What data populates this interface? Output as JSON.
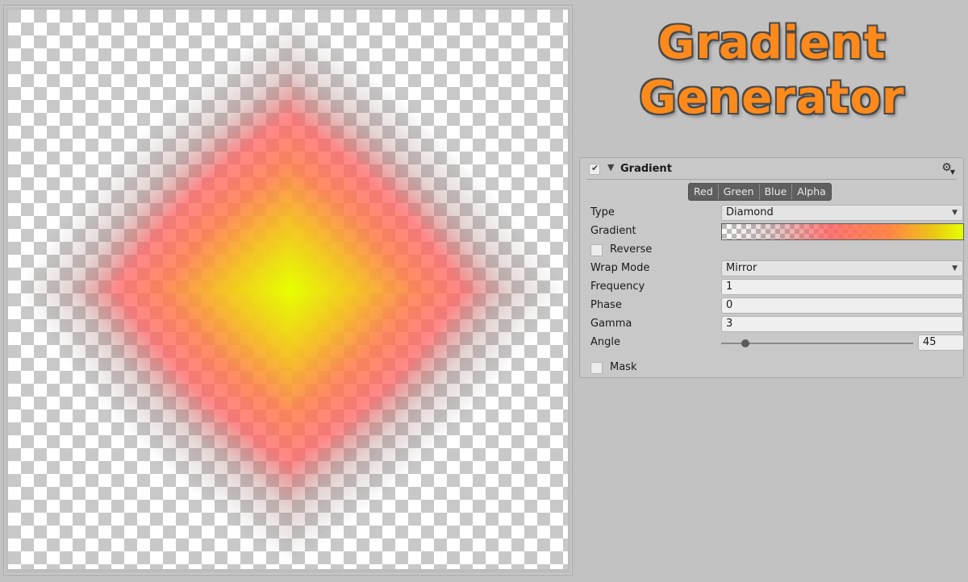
{
  "logo": {
    "line1": "Gradient",
    "line2": "Generator"
  },
  "preview": {
    "type": "Diamond",
    "gradient_stops": [
      "transparent",
      "#ff6060",
      "#ff8a3c",
      "#e6ff00"
    ]
  },
  "panel": {
    "title": "Gradient",
    "enabled": true,
    "expanded": true,
    "gear_icon": "gear-icon",
    "channels": [
      "Red",
      "Green",
      "Blue",
      "Alpha"
    ],
    "fields": {
      "type": {
        "label": "Type",
        "value": "Diamond"
      },
      "gradient": {
        "label": "Gradient"
      },
      "reverse": {
        "label": "Reverse",
        "checked": false
      },
      "wrap_mode": {
        "label": "Wrap Mode",
        "value": "Mirror"
      },
      "frequency": {
        "label": "Frequency",
        "value": "1"
      },
      "phase": {
        "label": "Phase",
        "value": "0"
      },
      "gamma": {
        "label": "Gamma",
        "value": "3"
      },
      "angle": {
        "label": "Angle",
        "value": "45",
        "slider_fraction": 0.125
      },
      "mask": {
        "label": "Mask",
        "checked": false
      }
    }
  }
}
